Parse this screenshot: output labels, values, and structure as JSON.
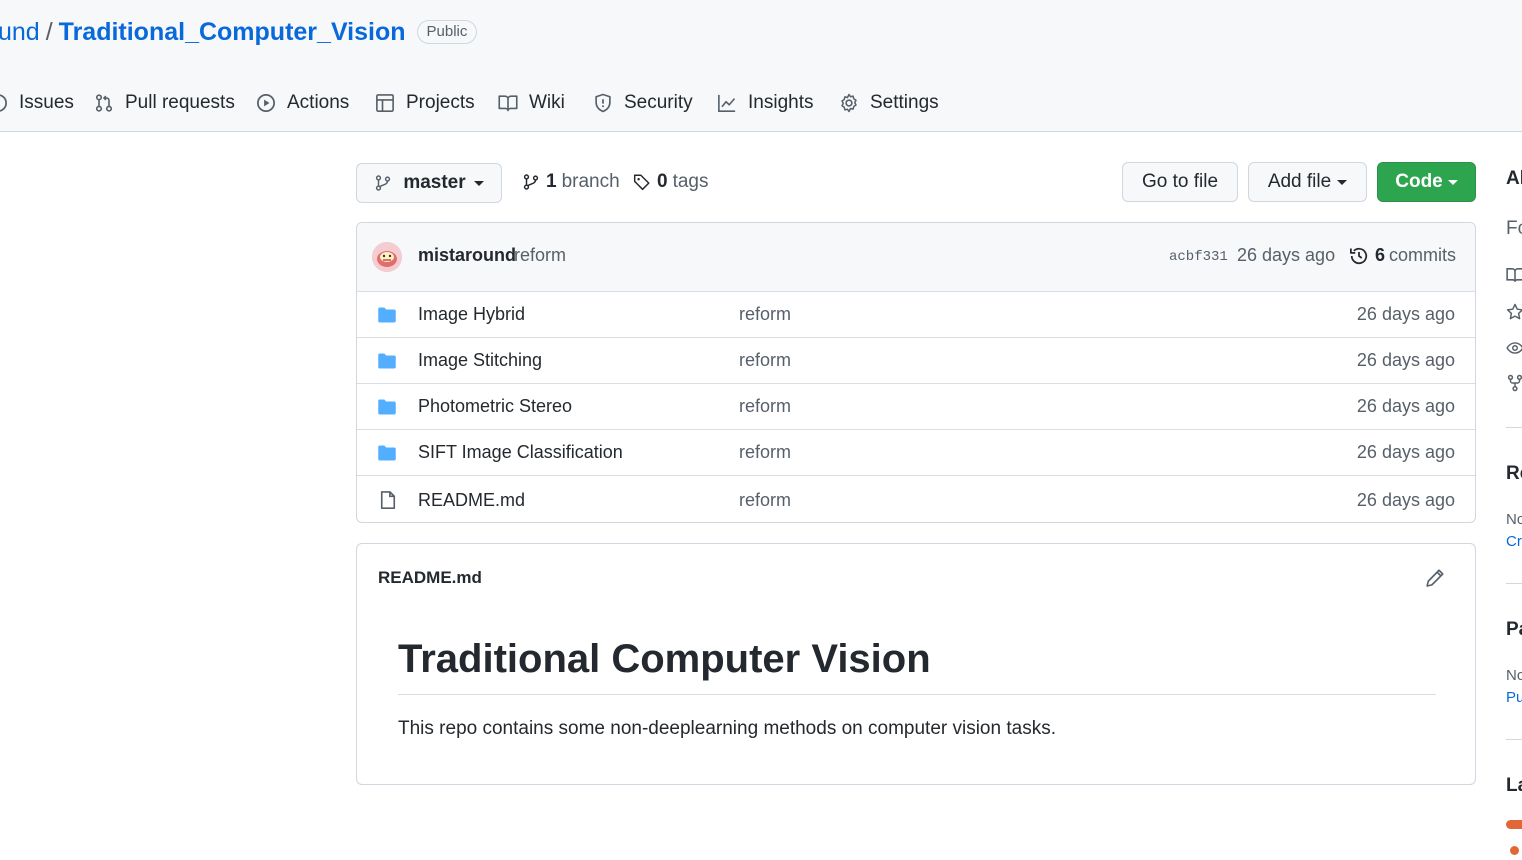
{
  "repo": {
    "owner": "und",
    "separator": "/",
    "name": "Traditional_Computer_Vision",
    "visibility": "Public"
  },
  "tabs": [
    {
      "label": "Issues",
      "icon": "issue-icon"
    },
    {
      "label": "Pull requests",
      "icon": "pull-request-icon"
    },
    {
      "label": "Actions",
      "icon": "play-icon"
    },
    {
      "label": "Projects",
      "icon": "table-icon"
    },
    {
      "label": "Wiki",
      "icon": "book-icon"
    },
    {
      "label": "Security",
      "icon": "shield-icon"
    },
    {
      "label": "Insights",
      "icon": "graph-icon"
    },
    {
      "label": "Settings",
      "icon": "gear-icon"
    }
  ],
  "branch_bar": {
    "branch": "master",
    "branch_count": "1",
    "branch_label": "branch",
    "tag_count": "0",
    "tag_label": "tags",
    "go_to_file": "Go to file",
    "add_file": "Add file",
    "code": "Code"
  },
  "latest_commit": {
    "author": "mistaround",
    "message": "reform",
    "sha": "acbf331",
    "time": "26 days ago",
    "commit_count": "6",
    "commit_label": "commits"
  },
  "files": [
    {
      "type": "folder",
      "name": "Image Hybrid",
      "message": "reform",
      "age": "26 days ago"
    },
    {
      "type": "folder",
      "name": "Image Stitching",
      "message": "reform",
      "age": "26 days ago"
    },
    {
      "type": "folder",
      "name": "Photometric Stereo",
      "message": "reform",
      "age": "26 days ago"
    },
    {
      "type": "folder",
      "name": "SIFT Image Classification",
      "message": "reform",
      "age": "26 days ago"
    },
    {
      "type": "file",
      "name": "README.md",
      "message": "reform",
      "age": "26 days ago"
    }
  ],
  "readme": {
    "filename": "README.md",
    "heading": "Traditional Computer Vision",
    "body": "This repo contains some non-deeplearning methods on computer vision tasks."
  },
  "sidebar": {
    "about_heading": "Al",
    "description": "Fc",
    "releases_heading": "Re",
    "releases_text": "Nc",
    "releases_link": "Cr",
    "packages_heading": "Pa",
    "packages_text": "Nc",
    "packages_link": "Pu",
    "languages_heading": "La"
  },
  "colors": {
    "link": "#0969da",
    "code_button": "#2da44e",
    "folder": "#54aeff",
    "language_bar": "#e16737"
  }
}
